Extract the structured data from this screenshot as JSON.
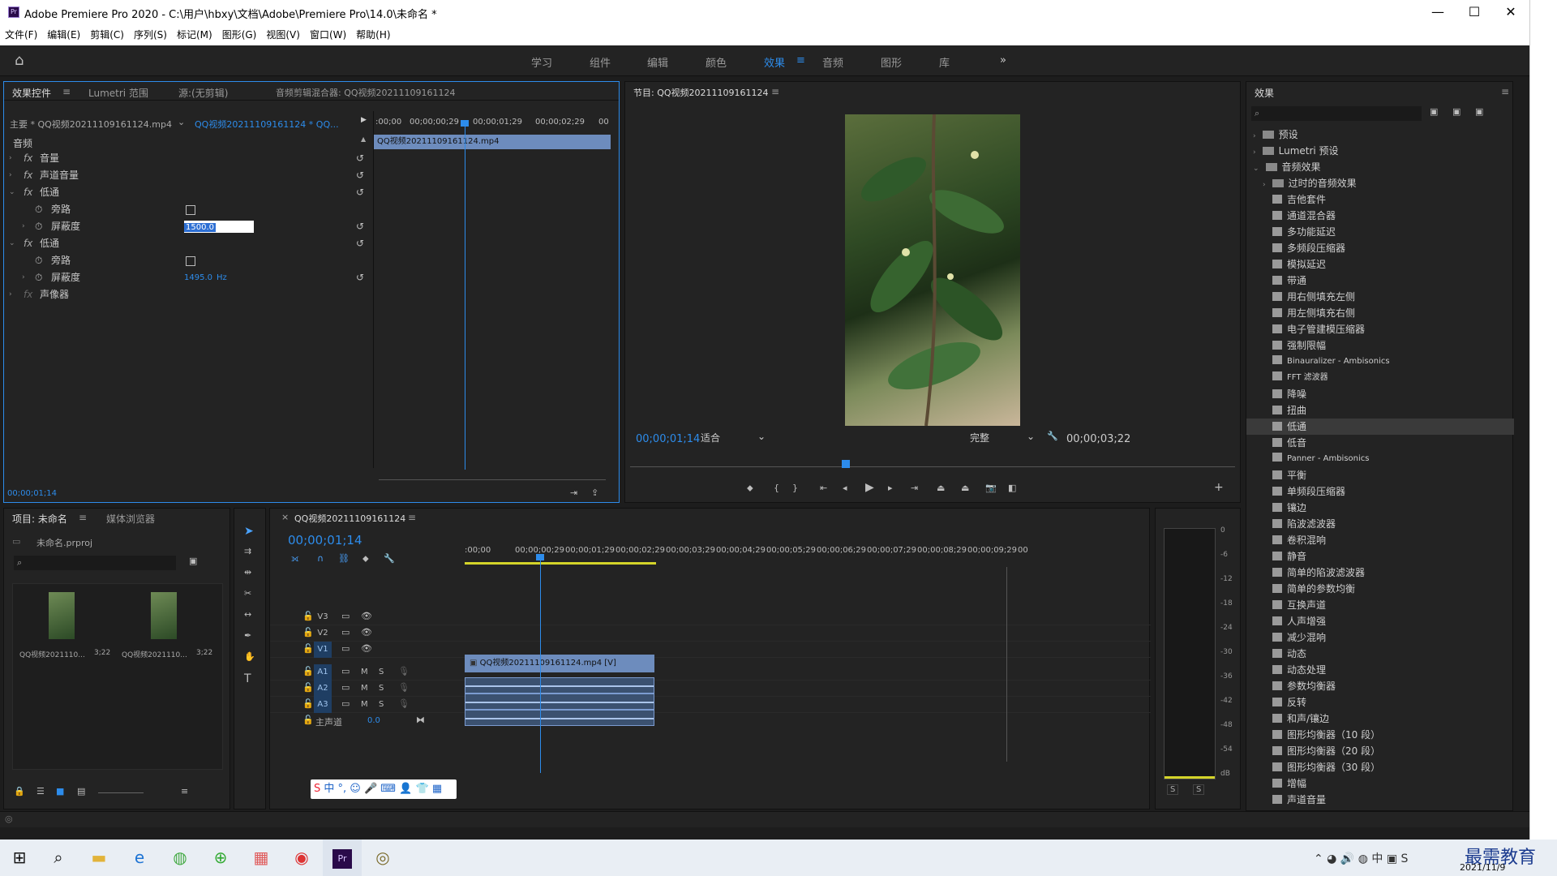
{
  "window": {
    "title": "Adobe Premiere Pro 2020 - C:\\用户\\hbxy\\文档\\Adobe\\Premiere Pro\\14.0\\未命名 *",
    "app_icon": "Pr",
    "minimize": "—",
    "maximize": "☐",
    "close": "✕"
  },
  "menu": [
    "文件(F)",
    "编辑(E)",
    "剪辑(C)",
    "序列(S)",
    "标记(M)",
    "图形(G)",
    "视图(V)",
    "窗口(W)",
    "帮助(H)"
  ],
  "workspaces": [
    "学习",
    "组件",
    "编辑",
    "颜色",
    "效果",
    "音频",
    "图形",
    "库"
  ],
  "workspace_active": "效果",
  "workspace_more": "»",
  "effect_controls": {
    "tabs": [
      "效果控件",
      "Lumetri 范围",
      "源:(无剪辑)",
      "音频剪辑混合器: QQ视频20211109161124"
    ],
    "master": "主要 * QQ视频20211109161124.mp4",
    "clip": "QQ视频20211109161124 * QQ...",
    "section": "音频",
    "rows": [
      {
        "label": "音量",
        "type": "fx"
      },
      {
        "label": "声道音量",
        "type": "fx"
      },
      {
        "label": "低通",
        "type": "fx"
      },
      {
        "label": "旁路",
        "type": "param"
      },
      {
        "label": "屏蔽度",
        "type": "param",
        "value": "1500.0"
      },
      {
        "label": "低通",
        "type": "fx"
      },
      {
        "label": "旁路",
        "type": "param"
      },
      {
        "label": "屏蔽度",
        "type": "param",
        "value": "1495.0",
        "unit": "Hz"
      },
      {
        "label": "声像器",
        "type": "fx"
      }
    ],
    "ruler": [
      ":00;00",
      "00;00;00;29",
      "00;00;01;29",
      "00;00;02;29",
      "00"
    ],
    "clip_bar": "QQ视频20211109161124.mp4",
    "time": "00;00;01;14"
  },
  "program": {
    "title": "节目: QQ视频20211109161124",
    "timecode": "00;00;01;14",
    "fit": "适合",
    "quality": "完整",
    "duration": "00;00;03;22",
    "playhead": 0.35
  },
  "effects_panel": {
    "title": "效果",
    "folders": [
      "预设",
      "Lumetri 预设",
      "音频效果",
      "过时的音频效果"
    ],
    "items": [
      "吉他套件",
      "通道混合器",
      "多功能延迟",
      "多频段压缩器",
      "模拟延迟",
      "带通",
      "用右侧填充左侧",
      "用左侧填充右侧",
      "电子管建模压缩器",
      "强制限幅",
      "Binauralizer - Ambisonics",
      "FFT 滤波器",
      "降噪",
      "扭曲",
      "低通",
      "低音",
      "Panner - Ambisonics",
      "平衡",
      "单频段压缩器",
      "镶边",
      "陷波滤波器",
      "卷积混响",
      "静音",
      "简单的陷波滤波器",
      "简单的参数均衡",
      "互换声道",
      "人声增强",
      "减少混响",
      "动态",
      "动态处理",
      "参数均衡器",
      "反转",
      "和声/镶边",
      "图形均衡器（10 段）",
      "图形均衡器（20 段）",
      "图形均衡器（30 段）",
      "增幅",
      "声道音量"
    ],
    "selected": "低通"
  },
  "project": {
    "tabs": [
      "项目: 未命名",
      "媒体浏览器"
    ],
    "file": "未命名.prproj",
    "clips": [
      {
        "name": "QQ视频2021110...",
        "dur": "3;22"
      },
      {
        "name": "QQ视频2021110...",
        "dur": "3;22"
      }
    ]
  },
  "timeline": {
    "tab": "QQ视频20211109161124",
    "timecode": "00;00;01;14",
    "ruler": [
      ":00;00",
      "00;00;00;29",
      "00;00;01;29",
      "00;00;02;29",
      "00;00;03;29",
      "00;00;04;29",
      "00;00;05;29",
      "00;00;06;29",
      "00;00;07;29",
      "00;00;08;29",
      "00;00;09;29",
      "00"
    ],
    "video_tracks": [
      "V3",
      "V2",
      "V1"
    ],
    "audio_tracks": [
      "A1",
      "A2",
      "A3"
    ],
    "master": "主声道",
    "master_val": "0.0",
    "video_clip": "QQ视频20211109161124.mp4 [V]",
    "mute": "M",
    "solo": "S"
  },
  "meter": {
    "scale": [
      "0",
      "-6",
      "-12",
      "-18",
      "-24",
      "-30",
      "-36",
      "-42",
      "-48",
      "-54",
      "dB"
    ],
    "solo": [
      "S",
      "S"
    ]
  },
  "taskbar": {
    "date": "2021/11/9",
    "watermark": "最需教育"
  }
}
